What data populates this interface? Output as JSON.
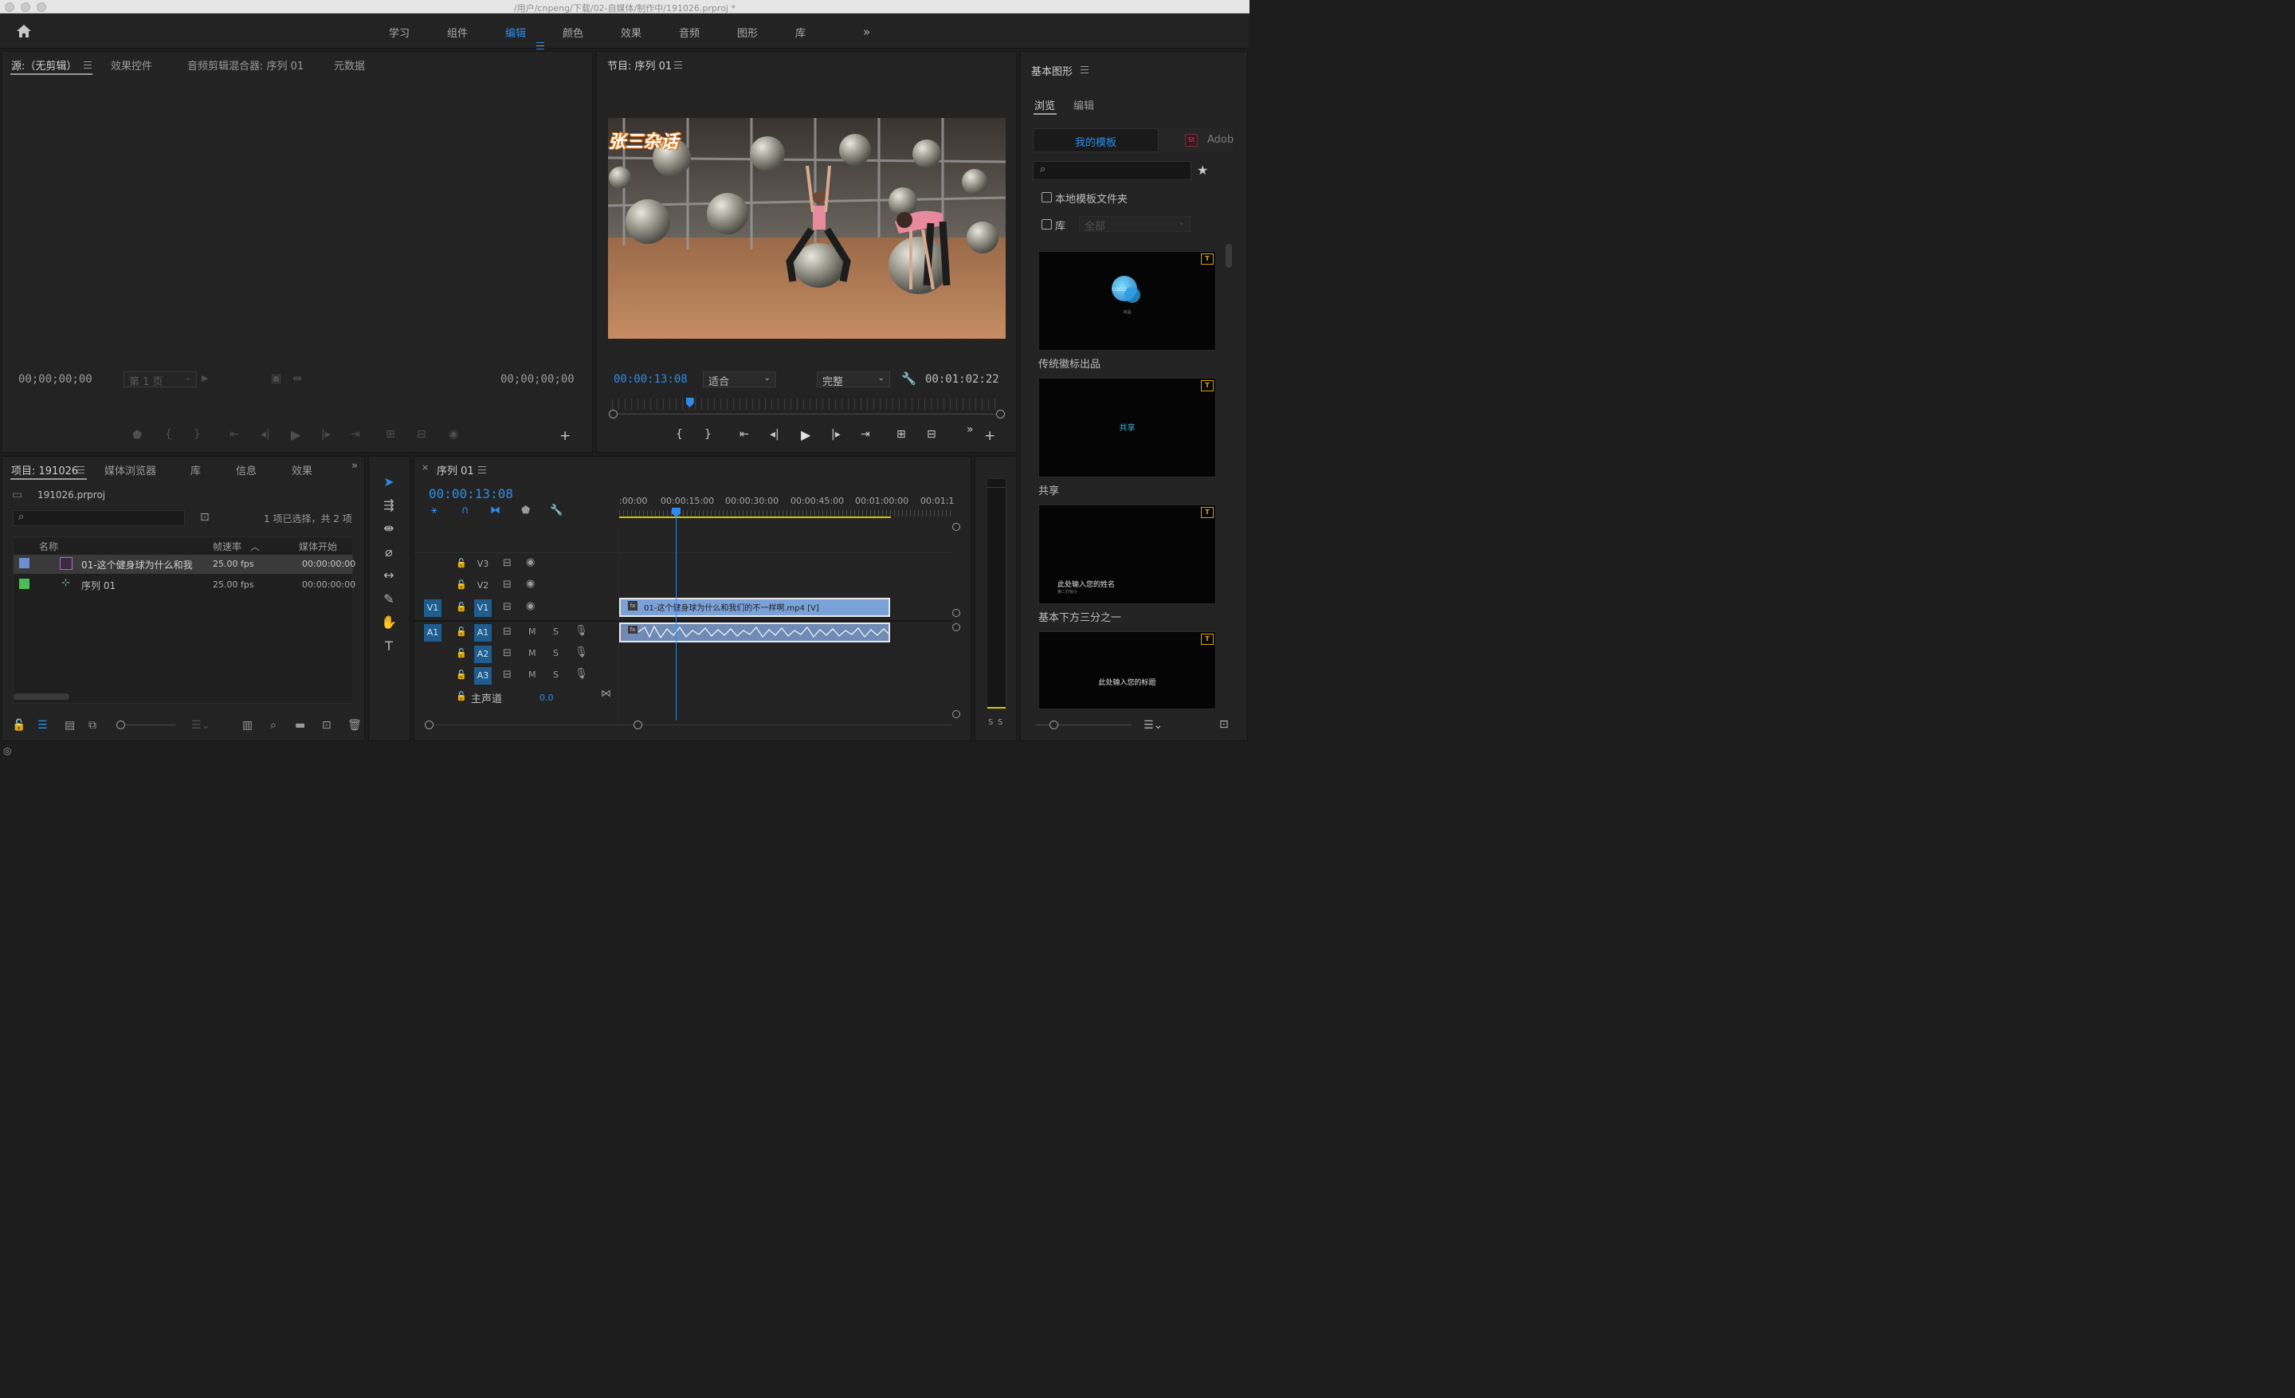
{
  "window": {
    "title": "/用户/cnpeng/下载/02-自媒体/制作中/191026.prproj *"
  },
  "workspaces": [
    "学习",
    "组件",
    "编辑",
    "颜色",
    "效果",
    "音频",
    "图形",
    "库"
  ],
  "workspace_active": "编辑",
  "source_panel": {
    "tabs": [
      "源:（无剪辑）",
      "效果控件",
      "音频剪辑混合器: 序列 01",
      "元数据"
    ],
    "timecode_in": "00;00;00;00",
    "page_select": "第 1 页",
    "timecode_out": "00;00;00;00"
  },
  "program_monitor": {
    "title": "节目: 序列 01",
    "overlay_title": "张三杂话",
    "timecode_current": "00:00:13:08",
    "fit_select": "适合",
    "quality_select": "完整",
    "timecode_duration": "00:01:02:22",
    "playhead_percent": 20
  },
  "project_panel": {
    "tabs": [
      "项目: 191026",
      "媒体浏览器",
      "库",
      "信息",
      "效果"
    ],
    "project_file": "191026.prproj",
    "selection_status": "1 项已选择，共 2 项",
    "search_placeholder": "",
    "columns": [
      "名称",
      "帧速率",
      "媒体开始"
    ],
    "items": [
      {
        "name": "01-这个健身球为什么和我",
        "fps": "25.00 fps",
        "start": "00:00:00:00",
        "color": "#6b8fd1",
        "selected": true
      },
      {
        "name": "序列 01",
        "fps": "25.00 fps",
        "start": "00:00:00:00",
        "color": "#4cbd55",
        "selected": false
      }
    ]
  },
  "timeline": {
    "tab": "序列 01",
    "timecode": "00:00:13:08",
    "ruler_labels": [
      ":00:00",
      "00:00:15:00",
      "00:00:30:00",
      "00:00:45:00",
      "00:01:00:00",
      "00:01:1"
    ],
    "video_tracks": [
      "V3",
      "V2",
      "V1"
    ],
    "audio_tracks": [
      "A1",
      "A2",
      "A3"
    ],
    "source_patch_video": "V1",
    "source_patch_audio": "A1",
    "master_label": "主声道",
    "master_value": "0.0",
    "mute_label": "M",
    "solo_label": "S",
    "clip_video_label": "01-这个健身球为什么和我们的不一样啊.mp4 [V]",
    "clip_fx": "fx",
    "meter_labels": [
      "S",
      "S"
    ]
  },
  "essential_graphics": {
    "title": "基本图形",
    "tabs": [
      "浏览",
      "编辑"
    ],
    "sources": [
      "我的模板",
      "Adobe"
    ],
    "adobe_badge": "St",
    "search_placeholder": "",
    "checkbox_local": "本地模板文件夹",
    "checkbox_library": "库",
    "library_select": "全部",
    "templates": [
      {
        "name": "传统徽标出品",
        "preview_text": "LOGO",
        "preview_sub": "出品"
      },
      {
        "name": "共享",
        "preview_text": "共享",
        "preview_sub": ""
      },
      {
        "name": "基本下方三分之一",
        "preview_text": "此处输入您的姓名",
        "preview_sub": "第二行标小"
      },
      {
        "name": "",
        "preview_text": "此处输入您的标题",
        "preview_sub": ""
      }
    ]
  }
}
